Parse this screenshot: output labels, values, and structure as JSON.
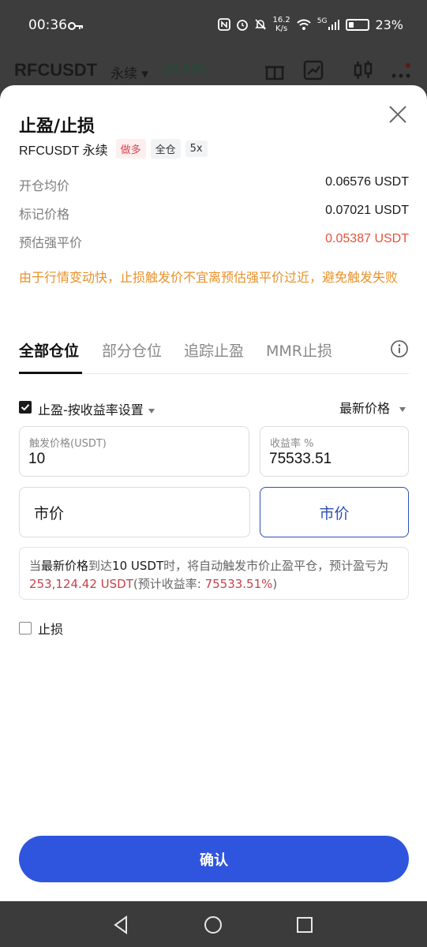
{
  "status_bar": {
    "time": "00:36",
    "speed_top": "16.2",
    "speed_bottom": "K/s",
    "network": "5G",
    "battery": "23%"
  },
  "background_header": {
    "symbol": "RFCUSDT",
    "contract_type": "永续",
    "change": "-20.21%"
  },
  "sheet": {
    "title": "止盈/止损",
    "symbol": "RFCUSDT 永续",
    "tags": [
      "做多",
      "全仓",
      "5x"
    ],
    "info": [
      {
        "label": "开仓均价",
        "value": "0.06576 USDT"
      },
      {
        "label": "标记价格",
        "value": "0.07021 USDT"
      },
      {
        "label": "预估强平价",
        "value": "0.05387 USDT"
      }
    ],
    "warning": "由于行情变动快，止损触发价不宜离预估强平价过近，避免触发失败",
    "tabs": [
      "全部仓位",
      "部分仓位",
      "追踪止盈",
      "MMR止损"
    ],
    "active_tab": "全部仓位",
    "take_profit": {
      "checked": true,
      "label": "止盈-按收益率设置",
      "price_type": "最新价格",
      "trigger_label": "触发价格(USDT)",
      "trigger_value": "10",
      "yield_label": "收益率 %",
      "yield_value": "75533.51",
      "order_type_left": "市价",
      "order_type_right": "市价"
    },
    "summary": {
      "p1": "当",
      "price_type": "最新价格",
      "p2": "到达",
      "trigger": "10 USDT",
      "p3": "时，将自动触发市价止盈平仓，预计盈亏为",
      "pnl": "253,124.42 USDT",
      "p4": "(预计收益率: ",
      "rate": "75533.51%",
      "p5": ")"
    },
    "stop_loss": {
      "checked": false,
      "label": "止损"
    },
    "confirm_label": "确认"
  },
  "colors": {
    "accent": "#2f55de",
    "warning": "#e8922a",
    "liquidation": "#e4533b",
    "long_tag": "#e0424c"
  },
  "icons": [
    "key-icon",
    "nfc-icon",
    "alarm-icon",
    "mute-icon",
    "wifi-icon",
    "signal-icon",
    "battery-icon",
    "gift-icon",
    "chart-icon",
    "candlestick-icon",
    "more-icon",
    "close-icon",
    "info-icon",
    "back-icon",
    "home-icon",
    "recents-icon"
  ]
}
